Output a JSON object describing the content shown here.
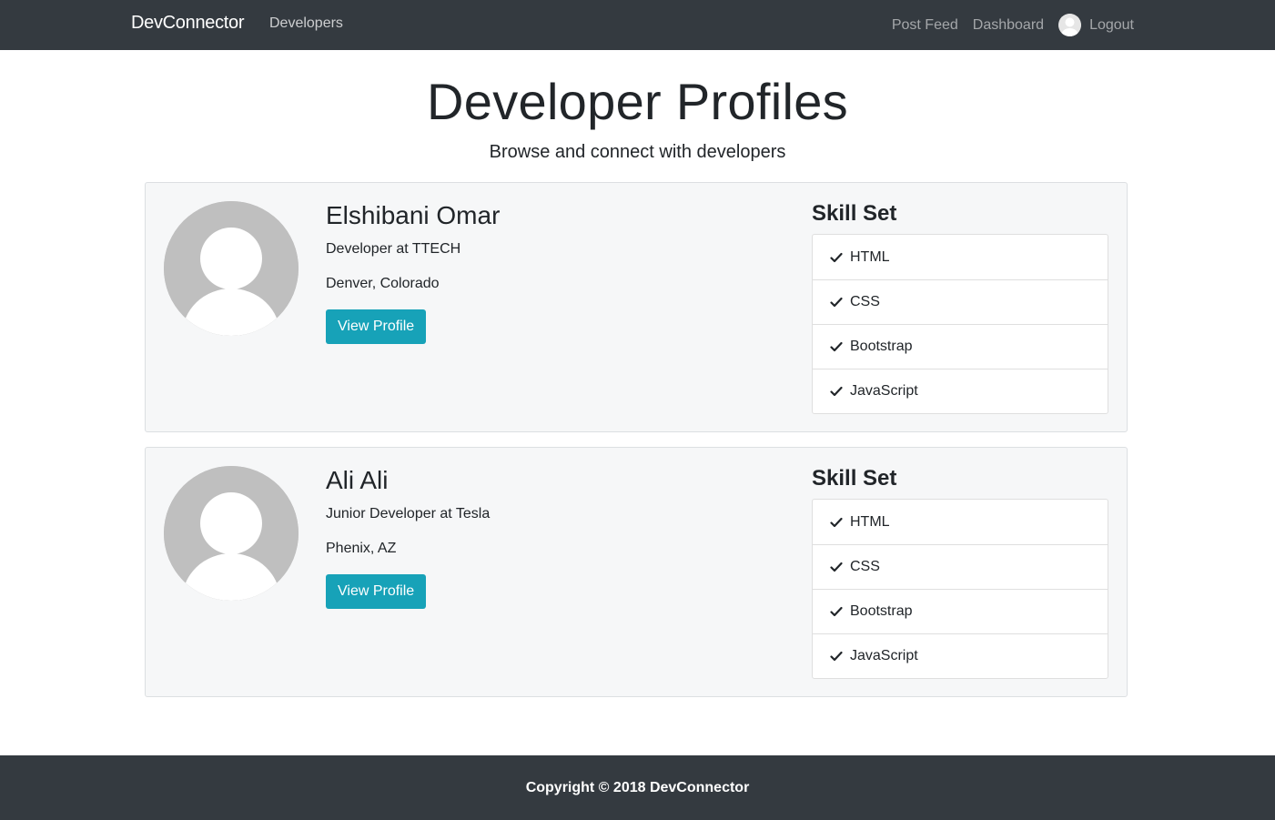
{
  "navbar": {
    "brand": "DevConnector",
    "developers_link": "Developers",
    "post_feed_link": "Post Feed",
    "dashboard_link": "Dashboard",
    "logout_link": "Logout"
  },
  "header": {
    "title": "Developer Profiles",
    "lead": "Browse and connect with developers"
  },
  "profiles": [
    {
      "name": "Elshibani Omar",
      "status": "Developer at TTECH",
      "location": "Denver, Colorado",
      "button_label": "View Profile",
      "skills_title": "Skill Set",
      "skills": [
        "HTML",
        "CSS",
        "Bootstrap",
        "JavaScript"
      ]
    },
    {
      "name": "Ali Ali",
      "status": "Junior Developer at Tesla",
      "location": "Phenix, AZ",
      "button_label": "View Profile",
      "skills_title": "Skill Set",
      "skills": [
        "HTML",
        "CSS",
        "Bootstrap",
        "JavaScript"
      ]
    }
  ],
  "footer": {
    "copyright": "Copyright © 2018 DevConnector"
  },
  "colors": {
    "navbar_bg": "#343a40",
    "button_bg": "#17a2b8",
    "card_bg": "#f6f7f8",
    "avatar_bg": "#bfbfbf"
  }
}
